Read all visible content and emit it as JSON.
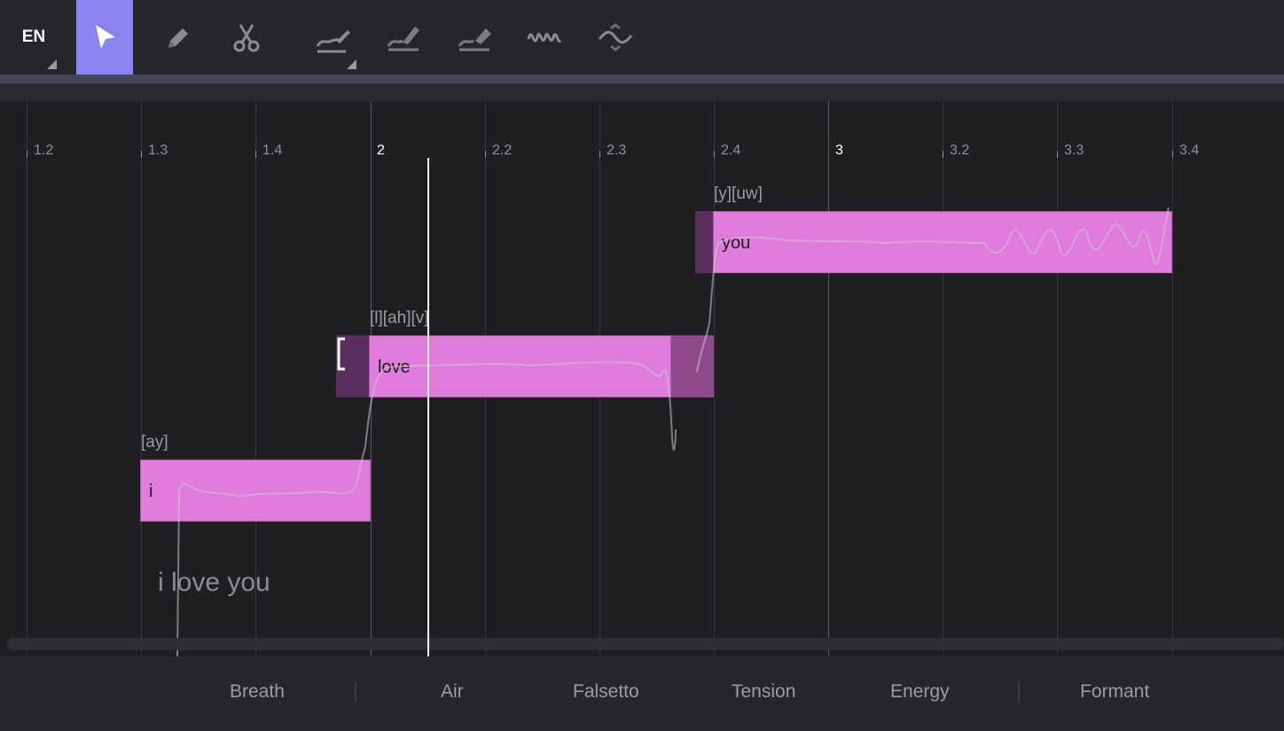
{
  "toolbar": {
    "language": "EN",
    "tools": [
      {
        "name": "select-tool",
        "icon": "pointer-arrow-icon",
        "active": true
      },
      {
        "name": "pencil-tool",
        "icon": "pencil-icon"
      },
      {
        "name": "scissors-tool",
        "icon": "scissors-icon"
      },
      {
        "name": "pitch-draw-tool",
        "icon": "pitch-pen-icon"
      },
      {
        "name": "pitch-flatten-tool",
        "icon": "pitch-flatten-icon"
      },
      {
        "name": "pitch-erase-tool",
        "icon": "pitch-eraser-icon"
      },
      {
        "name": "vibrato-tool",
        "icon": "vibrato-wave-icon"
      },
      {
        "name": "transition-tool",
        "icon": "transition-icon"
      }
    ]
  },
  "ruler": {
    "ticks": [
      "1.2",
      "1.3",
      "1.4",
      "2",
      "2.2",
      "2.3",
      "2.4",
      "3",
      "3.2",
      "3.3",
      "3.4"
    ]
  },
  "notes": [
    {
      "lyric": "i",
      "phonemes": "[ay]"
    },
    {
      "lyric": "love",
      "phonemes": "[l][ah][v]"
    },
    {
      "lyric": "you",
      "phonemes": "[y][uw]"
    }
  ],
  "lyrics_text": "i love you",
  "bottom_tabs": [
    "Breath",
    "Air",
    "Falsetto",
    "Tension",
    "Energy",
    "Formant"
  ],
  "colors": {
    "accent": "#8b84f0",
    "note_fill": "#e07ddc",
    "note_edge": "#5a2f5f",
    "background": "#1f1f22"
  }
}
